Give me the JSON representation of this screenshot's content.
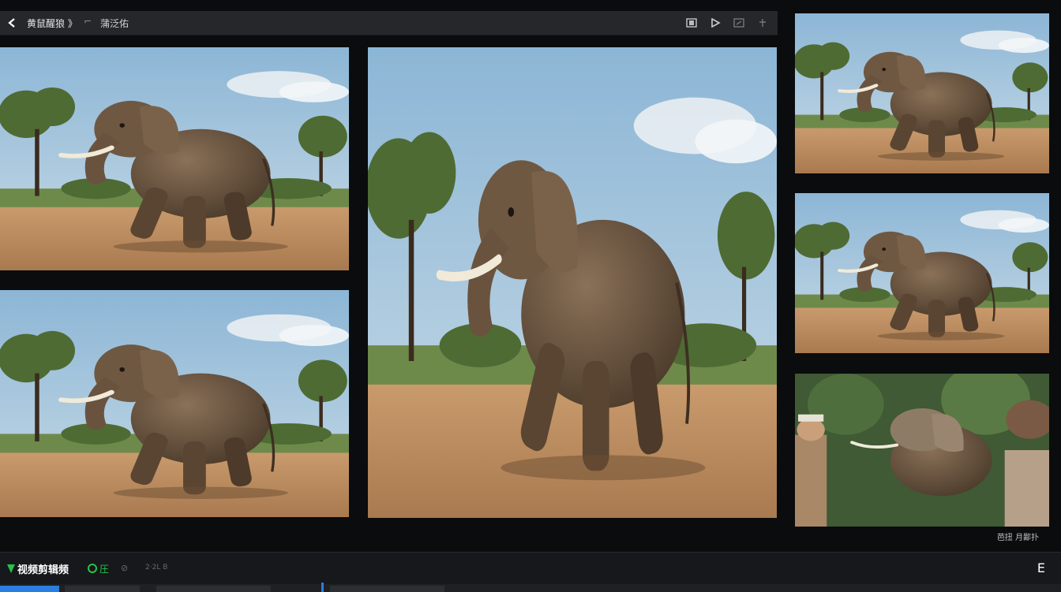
{
  "toolbar": {
    "title": "黄鼠醒狼 》",
    "separator": "⌐",
    "subtitle": "蒲泛佑",
    "icons": [
      "film-icon",
      "play-icon",
      "export-icon",
      "pin-icon"
    ]
  },
  "panels": [
    {
      "name": "clip-top-left",
      "subject": "elephant"
    },
    {
      "name": "clip-bottom-left",
      "subject": "elephant"
    },
    {
      "name": "clip-main",
      "subject": "elephant"
    },
    {
      "name": "clip-right-1",
      "subject": "elephant"
    },
    {
      "name": "clip-right-2",
      "subject": "elephant"
    },
    {
      "name": "clip-right-3",
      "subject": "elephant with people"
    }
  ],
  "watermark": "芭扭 月鄙扑",
  "bottombar": {
    "app_name": "视频剪辑频",
    "status_label": "圧",
    "mini_icon": "⊘",
    "time_label": "2·2L B",
    "corner_icon": "E"
  },
  "colors": {
    "accent": "#27c24c",
    "playhead": "#2a7de1"
  }
}
